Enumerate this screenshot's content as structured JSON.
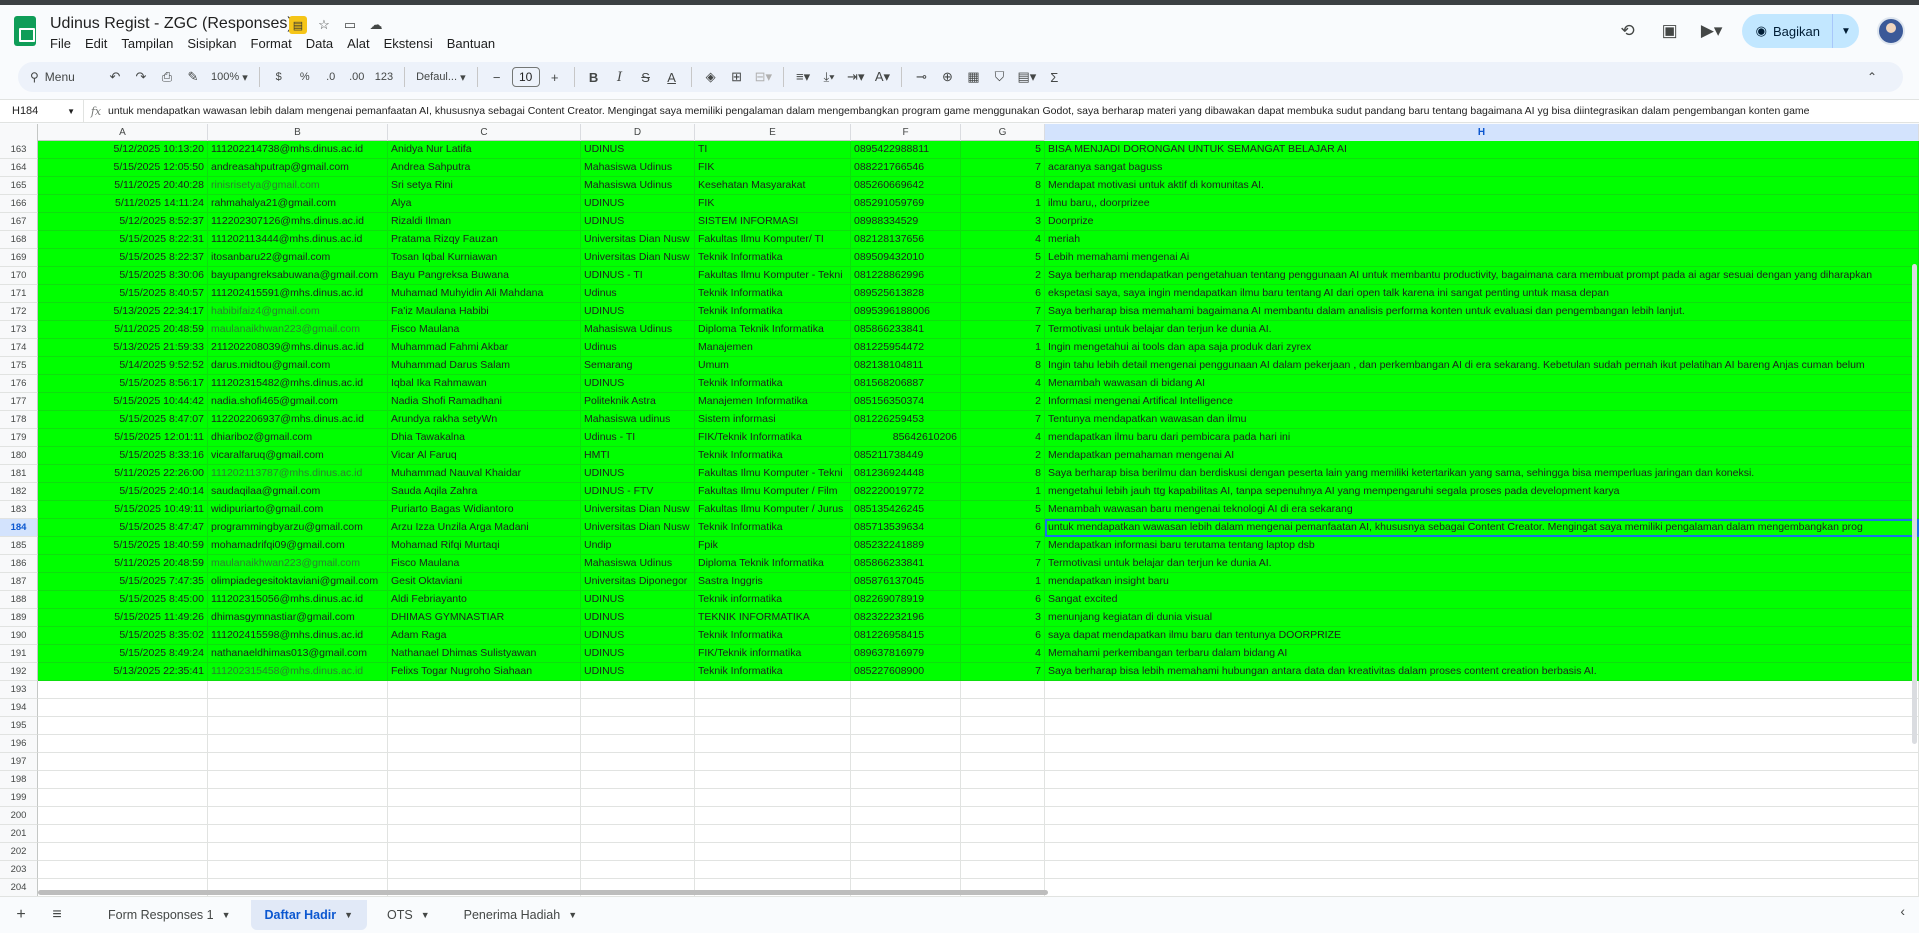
{
  "header": {
    "title": "Udinus Regist - ZGC (Responses)",
    "menu": [
      "File",
      "Edit",
      "Tampilan",
      "Sisipkan",
      "Format",
      "Data",
      "Alat",
      "Ekstensi",
      "Bantuan"
    ],
    "share_label": "Bagikan"
  },
  "toolbar": {
    "search_label": "Menu",
    "zoom": "100%",
    "currency": "$",
    "percent": "%",
    "dec_decrease": ".0",
    "dec_increase": ".00",
    "number_format": "123",
    "font": "Defaul...",
    "font_size": "10"
  },
  "formula_bar": {
    "cell_ref": "H184",
    "fx": "fx",
    "content": "untuk mendapatkan wawasan lebih dalam mengenai pemanfaatan AI, khususnya sebagai Content Creator. Mengingat saya memiliki pengalaman dalam mengembangkan program game menggunakan Godot, saya berharap materi yang dibawakan dapat membuka sudut pandang baru tentang bagaimana AI yg bisa diintegrasikan dalam pengembangan konten game"
  },
  "columns": [
    "A",
    "B",
    "C",
    "D",
    "E",
    "F",
    "G",
    "H"
  ],
  "rows": [
    {
      "n": "163",
      "a": "5/12/2025 10:13:20",
      "b": "111202214738@mhs.dinus.ac.id",
      "c": "Anidya Nur Latifa",
      "d": "UDINUS",
      "e": "TI",
      "f": "0895422988811",
      "g": "5",
      "h": "BISA MENJADI DORONGAN UNTUK SEMANGAT BELAJAR AI"
    },
    {
      "n": "164",
      "a": "5/15/2025 12:05:50",
      "b": "andreasahputrap@gmail.com",
      "c": "Andrea Sahputra",
      "d": "Mahasiswa Udinus",
      "e": "FIK",
      "f": "088221766546",
      "g": "7",
      "h": "acaranya sangat baguss"
    },
    {
      "n": "165",
      "a": "5/11/2025 20:40:28",
      "b": "rinisrisetya@gmail.com",
      "c": "Sri setya Rini",
      "d": "Mahasiswa Udinus",
      "e": " Kesehatan Masyarakat",
      "f": "085260669642",
      "g": "8",
      "h": "Mendapat motivasi untuk aktif di komunitas AI."
    },
    {
      "n": "166",
      "a": "5/11/2025 14:11:24",
      "b": "rahmahalya21@gmail.com",
      "c": "Alya",
      "d": "UDINUS",
      "e": "FIK",
      "f": "085291059769",
      "g": "1",
      "h": "ilmu baru,, doorprizee"
    },
    {
      "n": "167",
      "a": "5/12/2025 8:52:37",
      "b": "112202307126@mhs.dinus.ac.id",
      "c": "Rizaldi Ilman",
      "d": "UDINUS",
      "e": "SISTEM INFORMASI",
      "f": "08988334529",
      "g": "3",
      "h": "Doorprize"
    },
    {
      "n": "168",
      "a": "5/15/2025 8:22:31",
      "b": "111202113444@mhs.dinus.ac.id",
      "c": "Pratama Rizqy Fauzan",
      "d": "Universitas Dian Nusw",
      "e": "Fakultas Ilmu Komputer/ TI",
      "f": "082128137656",
      "g": "4",
      "h": "meriah"
    },
    {
      "n": "169",
      "a": "5/15/2025 8:22:37",
      "b": "itosanbaru22@gmail.com",
      "c": "Tosan Iqbal Kurniawan",
      "d": "Universitas Dian Nusw",
      "e": "Teknik Informatika",
      "f": "089509432010",
      "g": "5",
      "h": "Lebih memahami mengenai Ai"
    },
    {
      "n": "170",
      "a": "5/15/2025 8:30:06",
      "b": "bayupangreksabuwana@gmail.com",
      "c": "Bayu Pangreksa Buwana",
      "d": "UDINUS - TI",
      "e": "Fakultas Ilmu Komputer - Tekni",
      "f": "081228862996",
      "g": "2",
      "h": "Saya berharap mendapatkan pengetahuan tentang penggunaan AI untuk membantu productivity, bagaimana cara membuat prompt pada ai agar sesuai dengan yang diharapkan"
    },
    {
      "n": "171",
      "a": "5/15/2025 8:40:57",
      "b": "111202415591@mhs.dinus.ac.id",
      "c": "Muhamad Muhyidin Ali Mahdana",
      "d": "Udinus",
      "e": "Teknik Informatika",
      "f": "089525613828",
      "g": "6",
      "h": "ekspetasi saya, saya ingin mendapatkan ilmu baru tentang AI dari open talk karena ini sangat penting untuk masa depan"
    },
    {
      "n": "172",
      "a": "5/13/2025 22:34:17",
      "b": "habibifaiz4@gmail.com",
      "c": "Fa'iz Maulana Habibi",
      "d": "UDINUS",
      "e": "Teknik Informatika",
      "f": "0895396188006",
      "g": "7",
      "h": "Saya berharap bisa memahami bagaimana AI membantu dalam analisis performa konten untuk evaluasi dan pengembangan lebih lanjut."
    },
    {
      "n": "173",
      "a": "5/11/2025 20:48:59",
      "b": "maulanaikhwan223@gmail.com",
      "c": "Fisco Maulana",
      "d": "Mahasiswa Udinus",
      "e": "Diploma Teknik Informatika",
      "f": "085866233841",
      "g": "7",
      "h": "Termotivasi untuk belajar dan terjun ke dunia AI."
    },
    {
      "n": "174",
      "a": "5/13/2025 21:59:33",
      "b": "211202208039@mhs.dinus.ac.id",
      "c": "Muhammad Fahmi Akbar",
      "d": "Udinus",
      "e": "Manajemen",
      "f": "081225954472",
      "g": "1",
      "h": "Ingin mengetahui ai tools dan apa saja produk dari zyrex"
    },
    {
      "n": "175",
      "a": "5/14/2025 9:52:52",
      "b": "darus.midtou@gmail.com",
      "c": "Muhammad Darus Salam",
      "d": "Semarang",
      "e": "Umum",
      "f": "082138104811",
      "g": "8",
      "h": "Ingin tahu lebih detail mengenai penggunaan AI dalam pekerjaan , dan perkembangan AI di era sekarang. Kebetulan sudah pernah ikut pelatihan AI bareng Anjas cuman belum"
    },
    {
      "n": "176",
      "a": "5/15/2025 8:56:17",
      "b": "111202315482@mhs.dinus.ac.id",
      "c": "Iqbal Ika Rahmawan",
      "d": "UDINUS",
      "e": "Teknik Informatika",
      "f": "081568206887",
      "g": "4",
      "h": "Menambah wawasan di bidang AI"
    },
    {
      "n": "177",
      "a": "5/15/2025 10:44:42",
      "b": "nadia.shofi465@gmail.com",
      "c": "Nadia Shofi Ramadhani",
      "d": "Politeknik Astra",
      "e": "Manajemen Informatika",
      "f": "085156350374",
      "g": "2",
      "h": "Informasi mengenai Artifical Intelligence"
    },
    {
      "n": "178",
      "a": "5/15/2025 8:47:07",
      "b": "112202206937@mhs.dinus.ac.id",
      "c": "Arundya rakha setyWn",
      "d": "Mahasiswa udinus",
      "e": "Sistem informasi",
      "f": "081226259453",
      "g": "7",
      "h": "Tentunya mendapatkan wawasan dan ilmu"
    },
    {
      "n": "179",
      "a": "5/15/2025 12:01:11",
      "b": "dhiariboz@gmail.com",
      "c": "Dhia Tawakalna",
      "d": "Udinus - TI",
      "e": "FIK/Teknik Informatika",
      "f": "85642610206",
      "g": "4",
      "h": "mendapatkan ilmu baru dari pembicara pada hari ini"
    },
    {
      "n": "180",
      "a": "5/15/2025 8:33:16",
      "b": "vicaralfaruq@gmail.com",
      "c": "Vicar Al Faruq",
      "d": "HMTI",
      "e": "Teknik Informatika",
      "f": "085211738449",
      "g": "2",
      "h": "Mendapatkan pemahaman mengenai AI"
    },
    {
      "n": "181",
      "a": "5/11/2025 22:26:00",
      "b": "111202113787@mhs.dinus.ac.id",
      "c": "Muhammad Nauval Khaidar",
      "d": "UDINUS",
      "e": "Fakultas Ilmu Komputer - Tekni",
      "f": "081236924448",
      "g": "8",
      "h": "Saya berharap bisa berilmu dan berdiskusi dengan peserta lain yang memiliki ketertarikan yang sama, sehingga bisa memperluas jaringan dan koneksi."
    },
    {
      "n": "182",
      "a": "5/15/2025 2:40:14",
      "b": "saudaqilaa@gmail.com",
      "c": "Sauda Aqila Zahra",
      "d": "UDINUS - FTV",
      "e": "Fakultas Ilmu Komputer / Film",
      "f": "082220019772",
      "g": "1",
      "h": "mengetahui lebih jauh ttg kapabilitas AI, tanpa sepenuhnya AI yang mempengaruhi segala proses pada development karya"
    },
    {
      "n": "183",
      "a": "5/15/2025 10:49:11",
      "b": "widipuriarto@gmail.com",
      "c": "Puriarto Bagas Widiantoro",
      "d": "Universitas Dian Nusw",
      "e": "Fakultas Ilmu Komputer / Jurus",
      "f": "085135426245",
      "g": "5",
      "h": "Menambah wawasan baru mengenai teknologi AI di era sekarang"
    },
    {
      "n": "184",
      "a": "5/15/2025 8:47:47",
      "b": "programmingbyarzu@gmail.com",
      "c": "Arzu Izza Unzila Arga Madani",
      "d": "Universitas Dian Nusw",
      "e": "Teknik Informatika",
      "f": "085713539634",
      "g": "6",
      "h": "untuk mendapatkan wawasan lebih dalam mengenai pemanfaatan AI, khususnya sebagai Content Creator. Mengingat saya memiliki pengalaman dalam mengembangkan prog"
    },
    {
      "n": "185",
      "a": "5/15/2025 18:40:59",
      "b": "mohamadrifqi09@gmail.com",
      "c": "Mohamad Rifqi Murtaqi",
      "d": "Undip",
      "e": "Fpik",
      "f": "085232241889",
      "g": "7",
      "h": "Mendapatkan informasi baru terutama tentang laptop dsb"
    },
    {
      "n": "186",
      "a": "5/11/2025 20:48:59",
      "b": "maulanaikhwan223@gmail.com",
      "c": "Fisco Maulana",
      "d": "Mahasiswa Udinus",
      "e": "Diploma Teknik Informatika",
      "f": "085866233841",
      "g": "7",
      "h": "Termotivasi untuk belajar dan terjun ke dunia AI."
    },
    {
      "n": "187",
      "a": "5/15/2025 7:47:35",
      "b": "olimpiadegesitoktaviani@gmail.com",
      "c": "Gesit Oktaviani",
      "d": "Universitas Diponegor",
      "e": "Sastra Inggris",
      "f": "085876137045",
      "g": "1",
      "h": "mendapatkan insight baru"
    },
    {
      "n": "188",
      "a": "5/15/2025 8:45:00",
      "b": "111202315056@mhs.dinus.ac.id",
      "c": "Aldi Febriayanto",
      "d": "UDINUS",
      "e": "Teknik informatika",
      "f": "082269078919",
      "g": "6",
      "h": "Sangat excited"
    },
    {
      "n": "189",
      "a": "5/15/2025 11:49:26",
      "b": "dhimasgymnastiar@gmail.com",
      "c": "DHIMAS GYMNASTIAR",
      "d": "UDINUS",
      "e": "TEKNIK INFORMATIKA",
      "f": "082322232196",
      "g": "3",
      "h": "menunjang kegiatan di dunia visual"
    },
    {
      "n": "190",
      "a": "5/15/2025 8:35:02",
      "b": "111202415598@mhs.dinus.ac.id",
      "c": "Adam Raga",
      "d": "UDINUS",
      "e": "Teknik Informatika",
      "f": "081226958415",
      "g": "6",
      "h": "saya dapat mendapatkan ilmu baru dan tentunya DOORPRIZE"
    },
    {
      "n": "191",
      "a": "5/15/2025 8:49:24",
      "b": "nathanaeldhimas013@gmail.com",
      "c": "Nathanael Dhimas Sulistyawan",
      "d": "UDINUS",
      "e": "FIK/Teknik informatika",
      "f": "089637816979",
      "g": "4",
      "h": "Memahami perkembangan terbaru dalam bidang AI"
    },
    {
      "n": "192",
      "a": "5/13/2025 22:35:41",
      "b": "111202315458@mhs.dinus.ac.id",
      "c": "Felixs Togar Nugroho Siahaan",
      "d": "UDINUS",
      "e": "Teknik Informatika",
      "f": "085227608900",
      "g": "7",
      "h": "Saya berharap bisa lebih memahami hubungan antara data dan kreativitas dalam proses content creation berbasis AI."
    }
  ],
  "empty_rows": [
    "193",
    "194",
    "195",
    "196",
    "197",
    "198",
    "199",
    "200",
    "201",
    "202",
    "203",
    "204"
  ],
  "sheets": [
    {
      "label": "Form Responses 1",
      "active": false
    },
    {
      "label": "Daftar Hadir",
      "active": true
    },
    {
      "label": "OTS",
      "active": false
    },
    {
      "label": "Penerima Hadiah",
      "active": false
    }
  ],
  "colors": {
    "highlight": "#00ff00",
    "accent": "#1a73e8",
    "share_bg": "#c2e7ff"
  }
}
